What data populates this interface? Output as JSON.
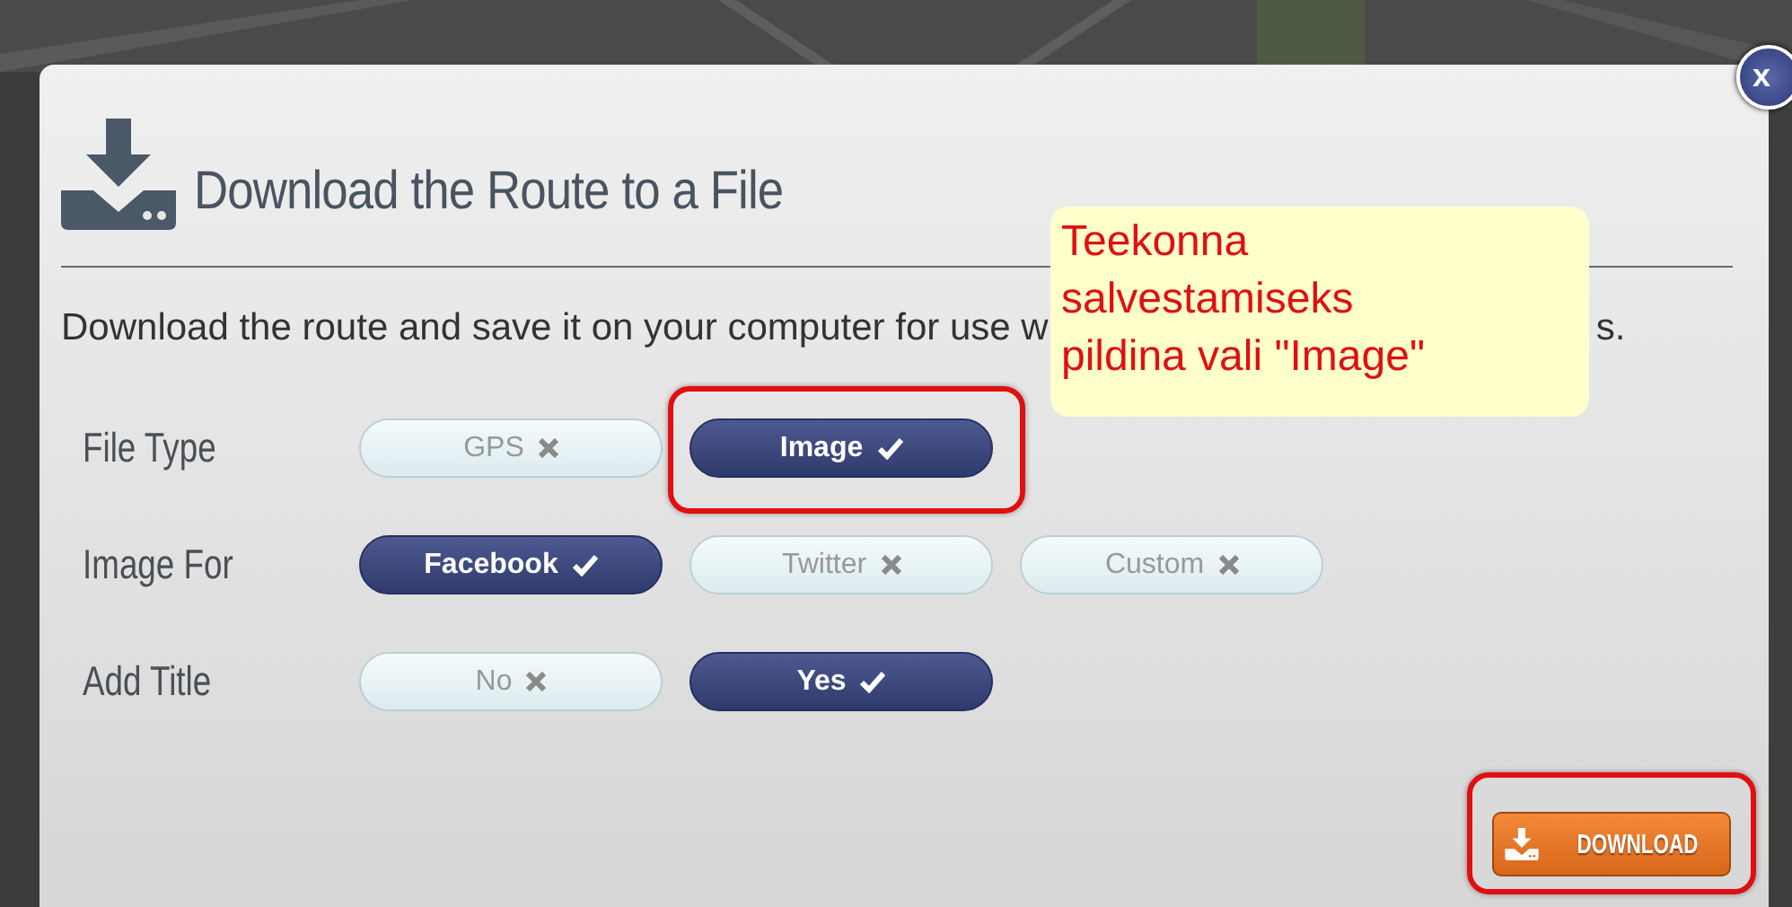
{
  "close": {
    "label": "x"
  },
  "dialog": {
    "title": "Download the Route to a File",
    "description_start": "Download the route and save it on your computer for use w",
    "description_end": "s.",
    "callout": "Teekonna salvestamiseks pildina vali \"Image\"",
    "options": [
      {
        "label": "File Type",
        "choices": [
          {
            "label": "GPS",
            "selected": false,
            "highlighted": false
          },
          {
            "label": "Image",
            "selected": true,
            "highlighted": true
          }
        ]
      },
      {
        "label": "Image For",
        "choices": [
          {
            "label": "Facebook",
            "selected": true,
            "highlighted": false
          },
          {
            "label": "Twitter",
            "selected": false,
            "highlighted": false
          },
          {
            "label": "Custom",
            "selected": false,
            "highlighted": false
          }
        ]
      },
      {
        "label": "Add Title",
        "choices": [
          {
            "label": "No",
            "selected": false,
            "highlighted": false
          },
          {
            "label": "Yes",
            "selected": true,
            "highlighted": false
          }
        ]
      }
    ],
    "download": {
      "label": "DOWNLOAD",
      "highlighted": true
    }
  }
}
